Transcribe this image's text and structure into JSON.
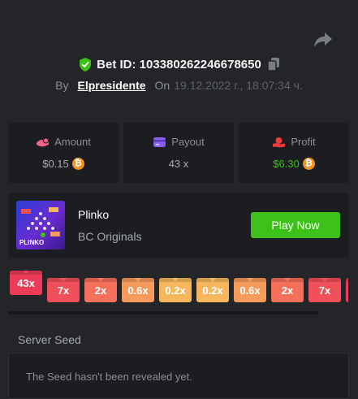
{
  "bet": {
    "label": "Bet ID: 103380262246678650",
    "by_label": "By",
    "user": "Elpresidente",
    "on_label": "On",
    "date": "19.12.2022 г., 18:07:34 ч."
  },
  "stats": [
    {
      "label": "Amount",
      "value": "$0.15",
      "icon": "amount-icon",
      "color": "#ed6384"
    },
    {
      "label": "Payout",
      "value": "43 x",
      "icon": "payout-icon",
      "color": "#8a5cf6"
    },
    {
      "label": "Profit",
      "value": "$6.30",
      "icon": "profit-icon",
      "color": "#ed3b3b"
    }
  ],
  "coin_symbol": "₿",
  "game": {
    "name": "Plinko",
    "provider": "BC Originals",
    "thumb_label": "PLINKO",
    "play_label": "Play Now"
  },
  "multipliers": [
    {
      "label": "43x",
      "color": "#ed3b5a",
      "active": true
    },
    {
      "label": "7x",
      "color": "#f0505a"
    },
    {
      "label": "2x",
      "color": "#f4705a"
    },
    {
      "label": "0.6x",
      "color": "#f59a5a"
    },
    {
      "label": "0.2x",
      "color": "#f6b75c"
    },
    {
      "label": "0.2x",
      "color": "#f6b75c"
    },
    {
      "label": "0.6x",
      "color": "#f59a5a"
    },
    {
      "label": "2x",
      "color": "#f4705a"
    },
    {
      "label": "7x",
      "color": "#f0505a"
    }
  ],
  "seed": {
    "label": "Server Seed",
    "text": "The Seed hasn't been revealed yet."
  },
  "colors": {
    "accent_green": "#3bc117",
    "background": "#232528",
    "panel": "#1c1d20"
  }
}
